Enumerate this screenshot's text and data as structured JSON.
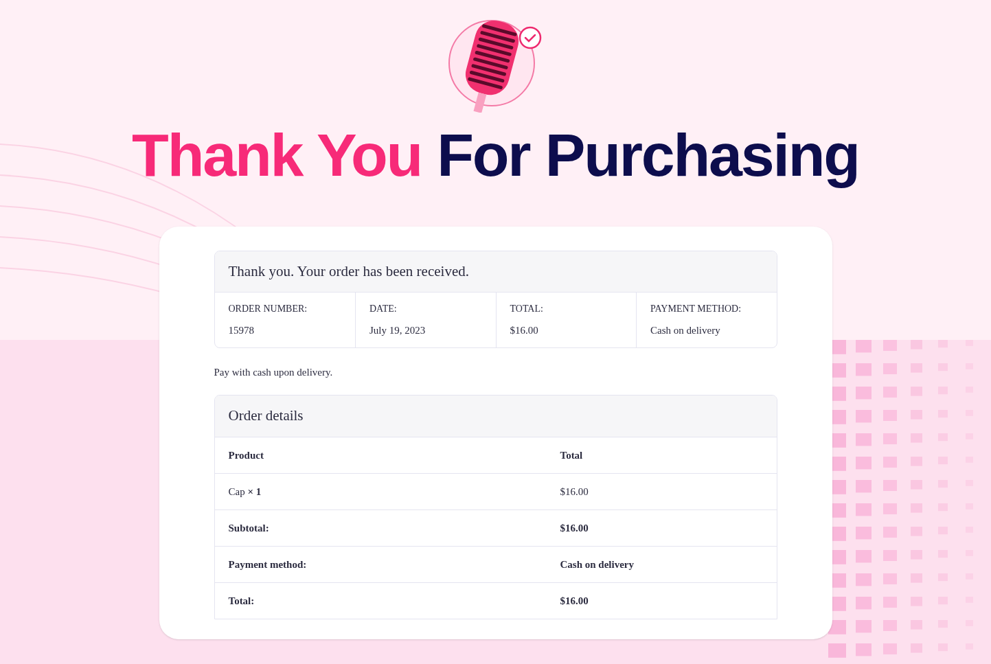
{
  "heading": {
    "highlight": "Thank You",
    "rest": "For Purchasing"
  },
  "notice": "Thank you. Your order has been received.",
  "overview": [
    {
      "label": "ORDER NUMBER:",
      "value": "15978"
    },
    {
      "label": "DATE:",
      "value": "July 19, 2023"
    },
    {
      "label": "TOTAL:",
      "value": "$16.00"
    },
    {
      "label": "PAYMENT METHOD:",
      "value": "Cash on delivery"
    }
  ],
  "payment_note": "Pay with cash upon delivery.",
  "order_details": {
    "title": "Order details",
    "columns": [
      "Product",
      "Total"
    ],
    "rows": [
      {
        "label": "Cap **× 1**",
        "value": "$16.00",
        "bold": false
      },
      {
        "label": "Subtotal:",
        "value": "$16.00",
        "bold": true
      },
      {
        "label": "Payment method:",
        "value": "Cash on delivery",
        "bold": true
      },
      {
        "label": "Total:",
        "value": "$16.00",
        "bold": true
      }
    ]
  }
}
